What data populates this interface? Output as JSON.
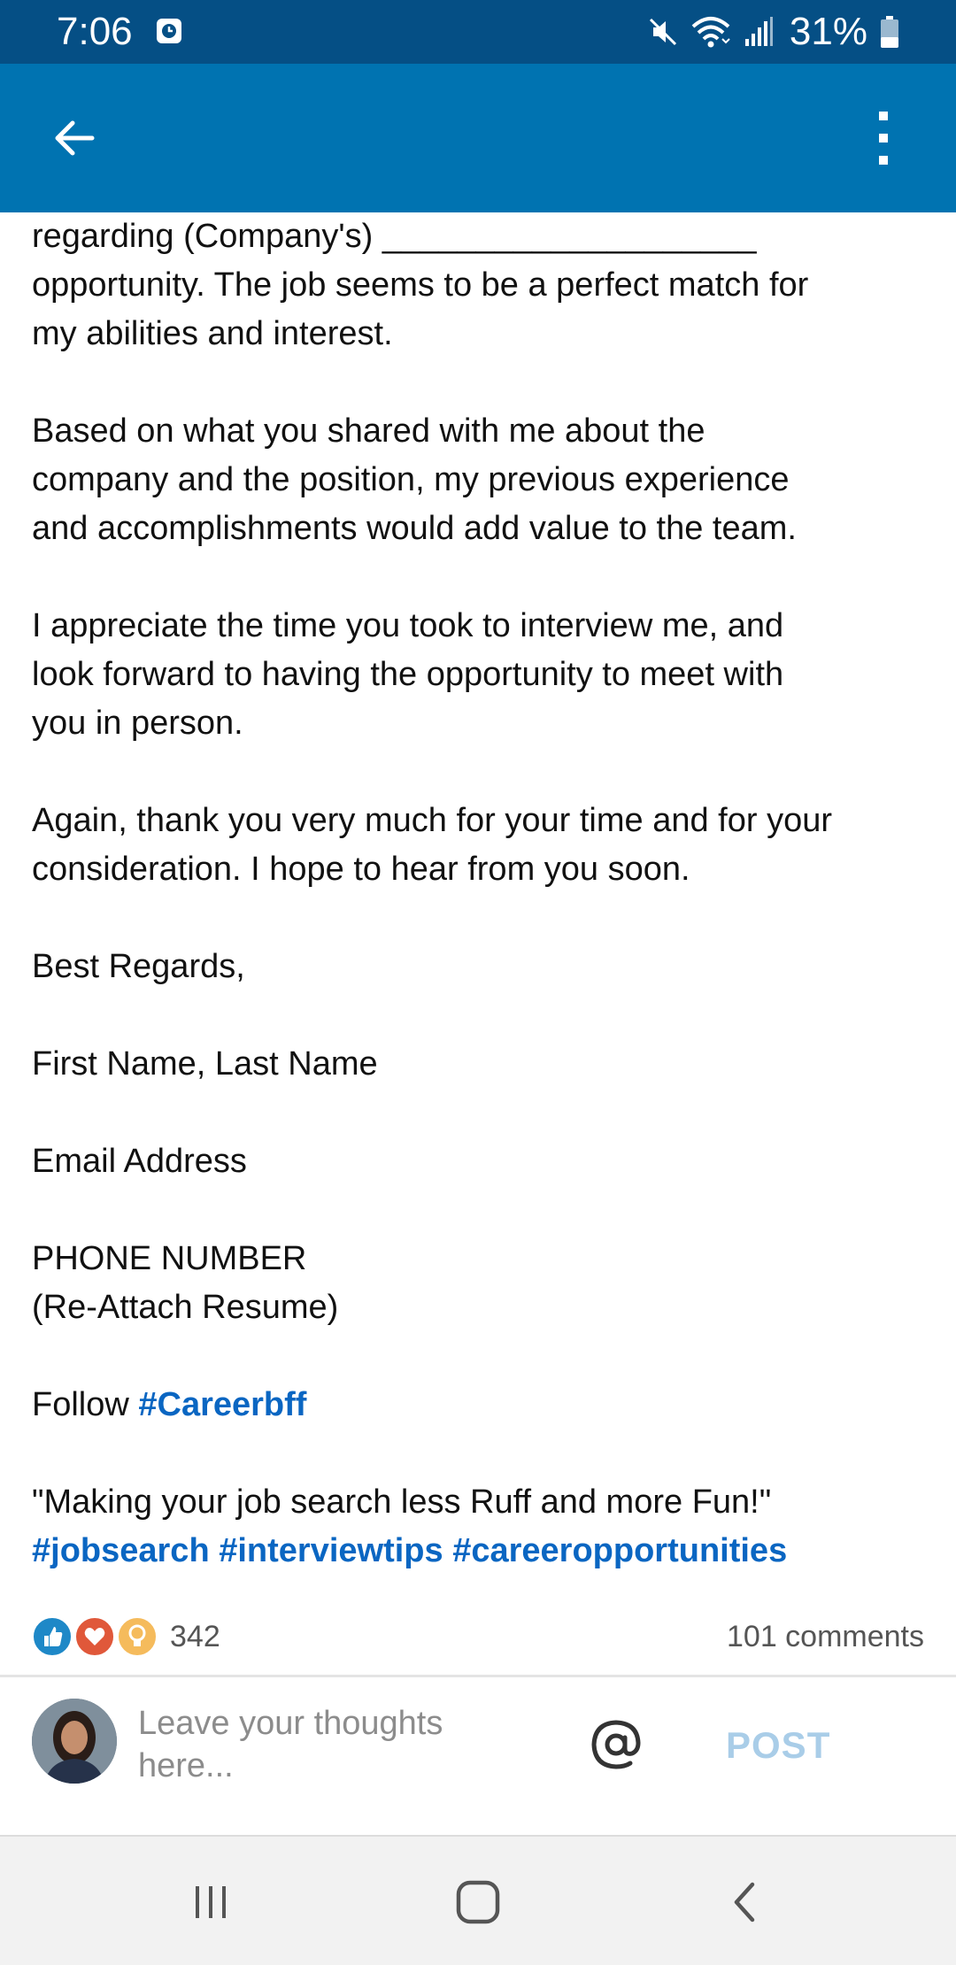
{
  "status_bar": {
    "time": "7:06",
    "battery": "31%",
    "icons": [
      "clock-icon",
      "mute-icon",
      "wifi-icon",
      "signal-icon",
      "battery-icon"
    ]
  },
  "app_bar": {
    "back_icon": "arrow-left-icon",
    "more_icon": "more-vertical-icon"
  },
  "post": {
    "lines_1": [
      "regarding (Company's) ____________________",
      "opportunity. The job seems to be a perfect match for",
      "my abilities and interest."
    ],
    "lines_2": [
      "Based on what you shared with me about the",
      "company and the position, my previous experience",
      "and accomplishments would add value to the team."
    ],
    "lines_3": [
      "I appreciate the time you took to interview me, and",
      "look forward to having the opportunity to meet with",
      "you in person."
    ],
    "lines_4": [
      "Again, thank you very much for your time and for your",
      "consideration. I hope to hear from you soon."
    ],
    "closing": "Best Regards,",
    "name": "First Name, Last Name",
    "email": "Email Address",
    "phone": "PHONE NUMBER",
    "resume": "(Re-Attach Resume)",
    "follow_text": "Follow",
    "follow_hashtag": "#Careerbff",
    "tagline": "\"Making your job search less Ruff and more Fun!\"",
    "hashtags": [
      "#jobsearch",
      "#interviewtips",
      "#careeropportunities"
    ]
  },
  "social": {
    "reaction_count": "342",
    "comments": "101 comments",
    "reaction_icons": [
      "like-icon",
      "love-icon",
      "insightful-icon"
    ],
    "colors": {
      "like": "#1e88c7",
      "love": "#e0583a",
      "insightful": "#f5bb5c"
    }
  },
  "compose": {
    "placeholder_line1": "Leave your thoughts",
    "placeholder_line2": "here...",
    "post_label": "POST",
    "mention_icon": "at-sign-icon"
  },
  "nav": {
    "icons": [
      "recent-apps-icon",
      "home-icon",
      "back-icon"
    ]
  },
  "colors": {
    "status_bar": "#054f85",
    "app_bar": "#0073b1",
    "hashtag": "#0a66c2",
    "post_button_disabled": "#a9cde8"
  }
}
